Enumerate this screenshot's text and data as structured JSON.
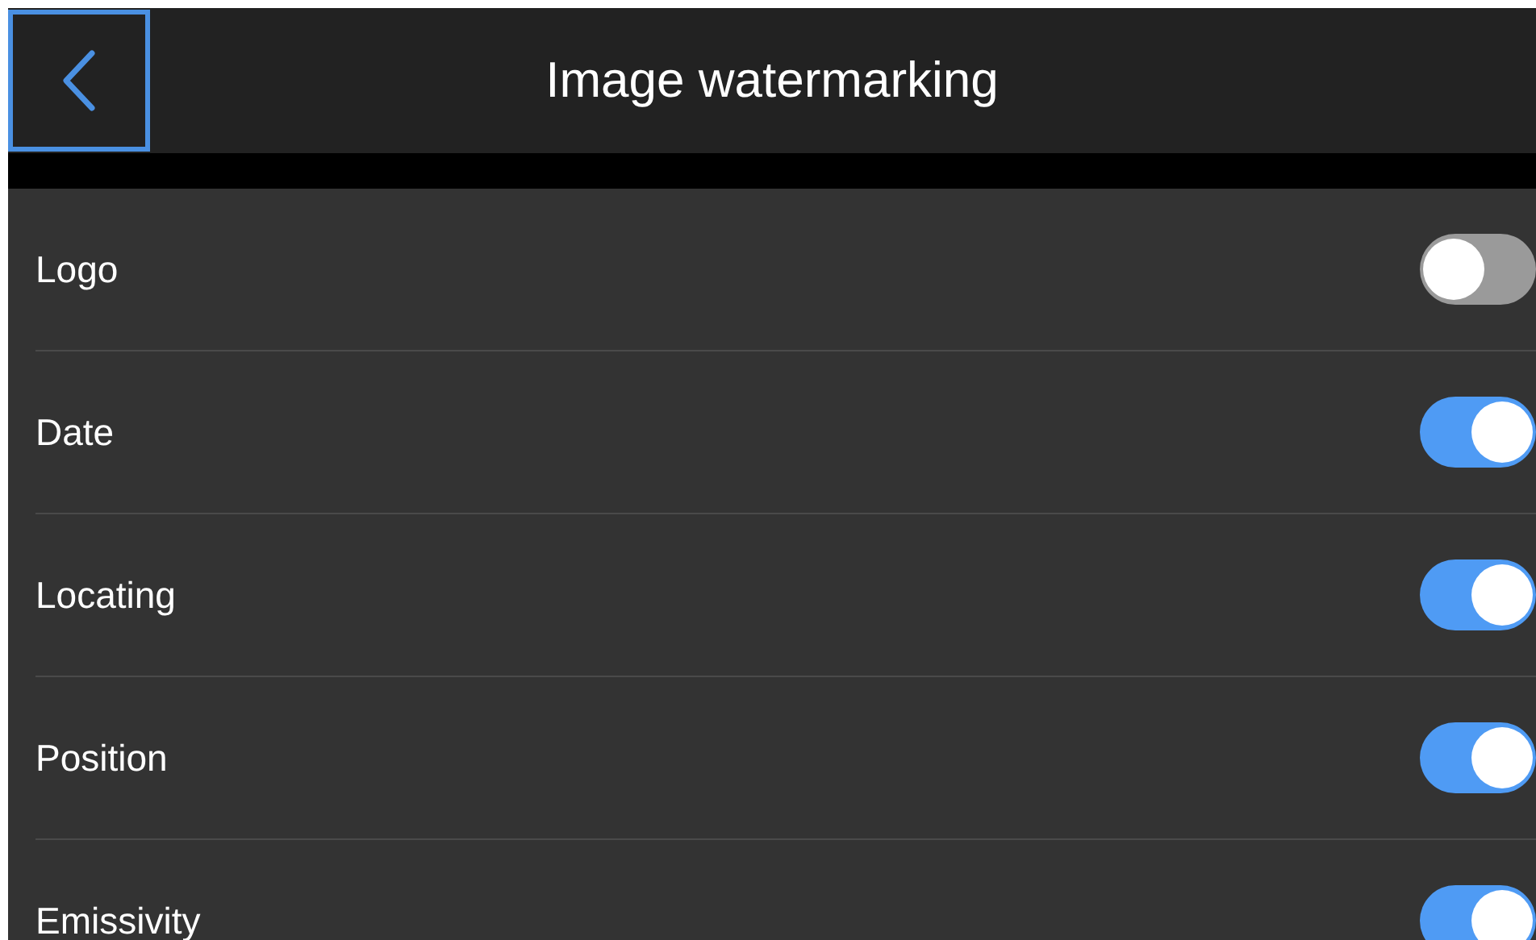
{
  "header": {
    "title": "Image watermarking"
  },
  "settings": [
    {
      "label": "Logo",
      "on": false
    },
    {
      "label": "Date",
      "on": true
    },
    {
      "label": "Locating",
      "on": true
    },
    {
      "label": "Position",
      "on": true
    },
    {
      "label": "Emissivity",
      "on": true
    }
  ]
}
